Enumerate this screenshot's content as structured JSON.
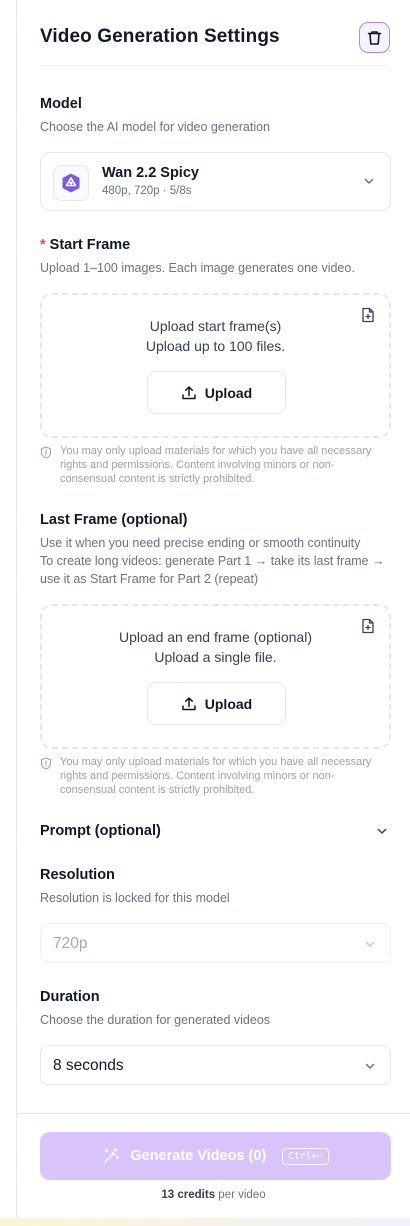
{
  "header": {
    "title": "Video Generation Settings",
    "trash_icon": "trash-icon"
  },
  "model": {
    "label": "Model",
    "help": "Choose the AI model for video generation",
    "selected_name": "Wan 2.2 Spicy",
    "selected_specs": "480p, 720p · 5/8s",
    "icon": "model-logo-icon",
    "accent": "#7c5cdb"
  },
  "start_frame": {
    "required_mark": "*",
    "label": "Start Frame",
    "help": "Upload 1–100 images. Each image generates one video.",
    "dropzone_line1": "Upload start frame(s)",
    "dropzone_line2": "Upload up to 100 files.",
    "upload_label": "Upload",
    "disclaimer": "You may only upload materials for which you have all necessary rights and permissions. Content involving minors or non-consensual content is strictly prohibited."
  },
  "last_frame": {
    "label": "Last Frame (optional)",
    "help_line1": "Use it when you need precise ending or smooth continuity",
    "help_line2": "To create long videos: generate Part 1 → take its last frame → use it as Start Frame for Part 2 (repeat)",
    "dropzone_line1": "Upload an end frame (optional)",
    "dropzone_line2": "Upload a single file.",
    "upload_label": "Upload",
    "disclaimer": "You may only upload materials for which you have all necessary rights and permissions. Content involving minors or non-consensual content is strictly prohibited."
  },
  "prompt": {
    "label": "Prompt (optional)"
  },
  "resolution": {
    "label": "Resolution",
    "help": "Resolution is locked for this model",
    "value": "720p",
    "disabled": true
  },
  "duration": {
    "label": "Duration",
    "help": "Choose the duration for generated videos",
    "value": "8 seconds"
  },
  "generate": {
    "label": "Generate Videos (0)",
    "shortcut": "Ctrl+⏎",
    "disabled": true,
    "color": "#d8c4fb"
  },
  "credits": {
    "amount": "13 credits",
    "suffix": " per video"
  }
}
